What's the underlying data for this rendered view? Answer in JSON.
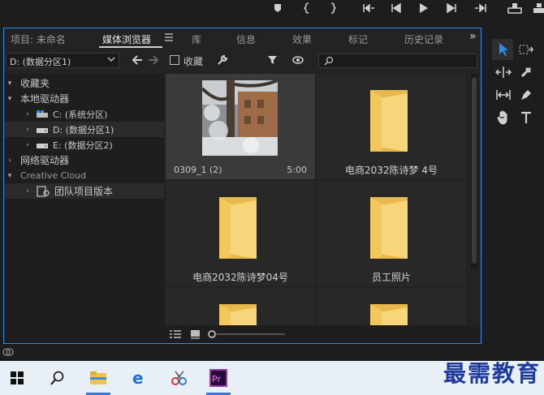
{
  "panel": {
    "tabs": [
      {
        "label": "项目: 未命名"
      },
      {
        "label": "媒体浏览器"
      },
      {
        "label": "库"
      },
      {
        "label": "信息"
      },
      {
        "label": "效果"
      },
      {
        "label": "标记"
      },
      {
        "label": "历史记录"
      }
    ],
    "tab_menu_icon": "hamburger-icon",
    "overflow_label": "»"
  },
  "toolbar": {
    "drive_select": "D: (数据分区1)",
    "favorites_label": "收藏"
  },
  "tree": {
    "items": [
      {
        "label": "收藏夹"
      },
      {
        "label": "本地驱动器"
      },
      {
        "label": "C: (系统分区)"
      },
      {
        "label": "D: (数据分区1)"
      },
      {
        "label": "E: (数据分区2)"
      },
      {
        "label": "网络驱动器"
      },
      {
        "label": "Creative Cloud"
      },
      {
        "label": "团队项目版本"
      }
    ]
  },
  "grid": {
    "items": [
      {
        "name": "0309_1 (2)",
        "duration": "5:00",
        "type": "video"
      },
      {
        "name": "电商2032陈诗梦 4号",
        "type": "folder"
      },
      {
        "name": "电商2032陈诗梦04号",
        "type": "folder"
      },
      {
        "name": "员工照片",
        "type": "folder"
      },
      {
        "name": "",
        "type": "folder"
      },
      {
        "name": "",
        "type": "folder"
      }
    ]
  },
  "watermark": "最需教育",
  "colors": {
    "accent": "#2d8ceb",
    "folder": "#f4cf6b",
    "pr_bg": "#2a0a3b",
    "pr_fg": "#e77bf8"
  }
}
